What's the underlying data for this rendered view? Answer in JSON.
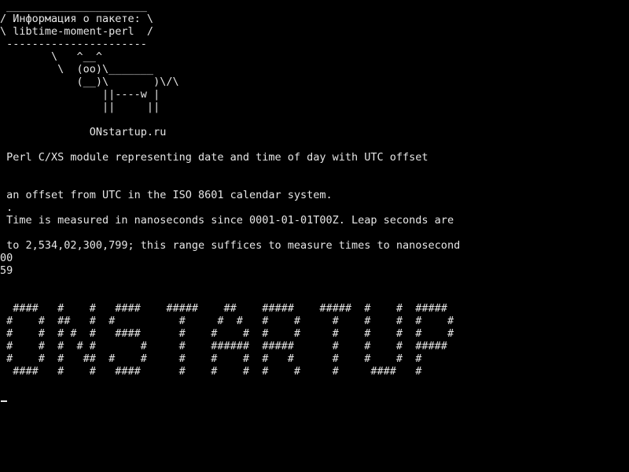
{
  "cowsay": {
    "bubble_top": " ______________________",
    "bubble_line1": "/ Информация о пакете: \\",
    "bubble_line2": "\\ libtime-moment-perl  /",
    "bubble_bottom": " ----------------------",
    "cow_line1": "        \\   ^__^",
    "cow_line2": "         \\  (oo)\\_______",
    "cow_line3": "            (__)\\       )\\/\\",
    "cow_line4": "                ||----w |",
    "cow_line5": "                ||     ||",
    "site": "              ONstartup.ru"
  },
  "description": {
    "line1": " Perl C/XS module representing date and time of day with UTC offset",
    "line2": " an offset from UTC in the ISO 8601 calendar system.",
    "line3": " .",
    "line4": " Time is measured in nanoseconds since 0001-01-01T00Z. Leap seconds are",
    "line5": " to 2,534,02,300,799; this range suffices to measure times to nanosecond",
    "line6": "00",
    "line7": "59"
  },
  "banner": {
    "row1": "  ####   #    #   ####    #####    ##    #####    #####  #    #  #####",
    "row2": " #    #  ##   #  #          #     #  #   #    #     #    #    #  #    #",
    "row3": " #    #  # #  #   ####      #    #    #  #    #     #    #    #  #    #",
    "row4": " #    #  #  # #       #     #    ######  #####      #    #    #  #####",
    "row5": " #    #  #   ##  #    #     #    #    #  #   #      #    #    #  #",
    "row6": "  ####   #    #   ####      #    #    #  #    #     #     ####   #"
  },
  "colors": {
    "background": "#000000",
    "text": "#e6e6e6"
  }
}
